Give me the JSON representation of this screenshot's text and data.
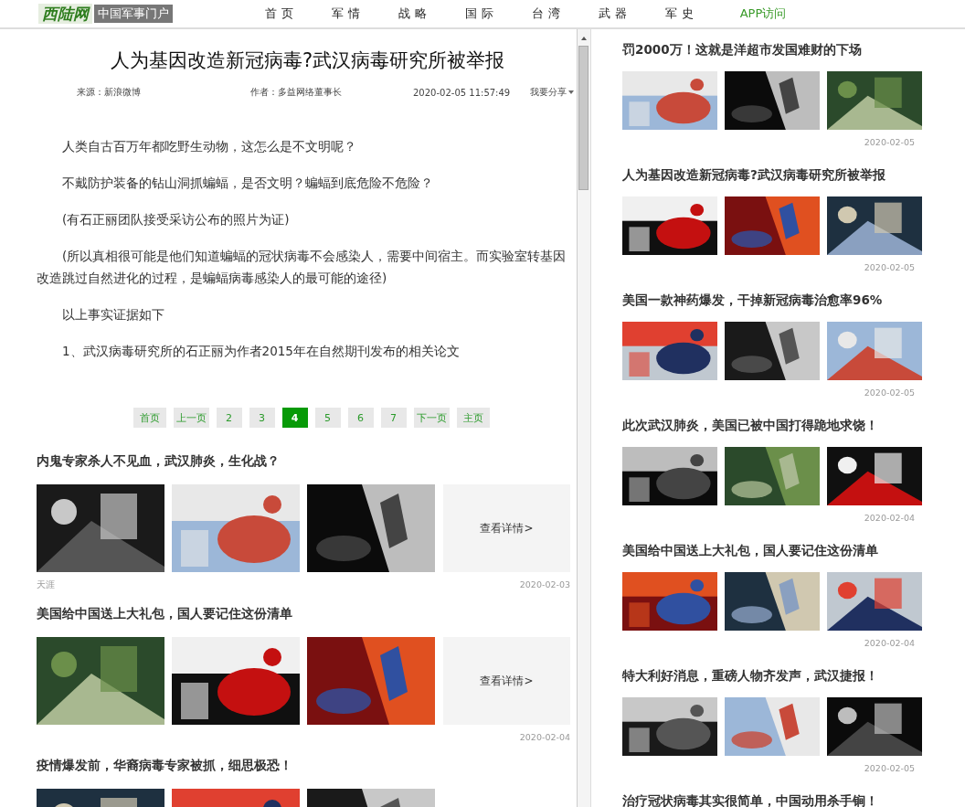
{
  "header": {
    "logo": "西陆网",
    "tagline": "中国军事门户",
    "nav": [
      {
        "label": "首 页",
        "kind": "plain"
      },
      {
        "label": "军 情",
        "kind": "plain"
      },
      {
        "label": "战 略",
        "kind": "plain"
      },
      {
        "label": "国 际",
        "kind": "plain"
      },
      {
        "label": "台 湾",
        "kind": "plain"
      },
      {
        "label": "武 器",
        "kind": "plain"
      },
      {
        "label": "军 史",
        "kind": "plain"
      },
      {
        "label": "APP访问",
        "kind": "app"
      }
    ]
  },
  "article": {
    "title": "人为基因改造新冠病毒?武汉病毒研究所被举报",
    "source": "来源：新浪微博",
    "author": "作者：多益网络董事长",
    "time": "2020-02-05 11:57:49",
    "share": "我要分享",
    "paragraphs": [
      "人类自古百万年都吃野生动物，这怎么是不文明呢？",
      "不戴防护装备的钻山洞抓蝙蝠，是否文明？蝙蝠到底危险不危险？",
      "(有石正丽团队接受采访公布的照片为证)",
      "(所以真相很可能是他们知道蝙蝠的冠状病毒不会感染人，需要中间宿主。而实验室转基因改造跳过自然进化的过程，是蝙蝠病毒感染人的最可能的途径)",
      "以上事实证据如下",
      "1、武汉病毒研究所的石正丽为作者2015年在自然期刊发布的相关论文"
    ]
  },
  "pagination": [
    {
      "label": "首页",
      "selected": false
    },
    {
      "label": "上一页",
      "selected": false
    },
    {
      "label": "2",
      "selected": false
    },
    {
      "label": "3",
      "selected": false
    },
    {
      "label": "4",
      "selected": true
    },
    {
      "label": "5",
      "selected": false
    },
    {
      "label": "6",
      "selected": false
    },
    {
      "label": "7",
      "selected": false
    },
    {
      "label": "下一页",
      "selected": false
    },
    {
      "label": "主页",
      "selected": false
    }
  ],
  "related": [
    {
      "title": "内鬼专家杀人不见血，武汉肺炎，生化战？",
      "more": "查看详情>",
      "source": "天涯",
      "date": "2020-02-03"
    },
    {
      "title": "美国给中国送上大礼包，国人要记住这份清单",
      "more": "查看详情>",
      "date": "2020-02-04"
    },
    {
      "title": "疫情爆发前，华裔病毒专家被抓，细思极恐！"
    }
  ],
  "sidebar": [
    {
      "title": "罚2000万！这就是洋超市发国难财的下场",
      "date": "2020-02-05"
    },
    {
      "title": "人为基因改造新冠病毒?武汉病毒研究所被举报",
      "date": "2020-02-05"
    },
    {
      "title": "美国一款神药爆发，干掉新冠病毒治愈率96%",
      "date": "2020-02-05"
    },
    {
      "title": "此次武汉肺炎，美国已被中国打得跪地求饶！",
      "date": "2020-02-04"
    },
    {
      "title": "美国给中国送上大礼包，国人要记住这份清单",
      "date": "2020-02-04"
    },
    {
      "title": "特大利好消息，重磅人物齐发声，武汉捷报！",
      "date": "2020-02-05"
    },
    {
      "title": "治疗冠状病毒其实很简单，中国动用杀手锏！"
    }
  ]
}
